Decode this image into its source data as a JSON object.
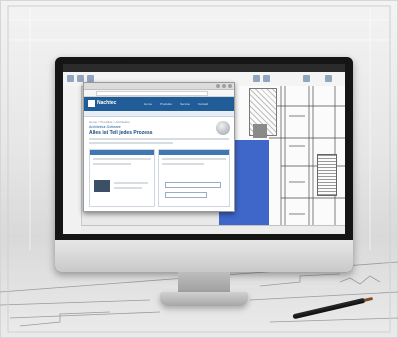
{
  "browser": {
    "site": {
      "brand": "Nachtec",
      "nav": [
        "Home",
        "Produkte",
        "Service",
        "Kontakt"
      ]
    },
    "content": {
      "breadcrumb": "Home > Produkte > Architektur",
      "eyebrow": "Architektur-Software",
      "page_title": "Alles ist Teil jedes Prozess"
    }
  },
  "colors": {
    "site_header": "#1f5c98",
    "cad_wall": "#3f67c9",
    "bezel": "#151515"
  }
}
